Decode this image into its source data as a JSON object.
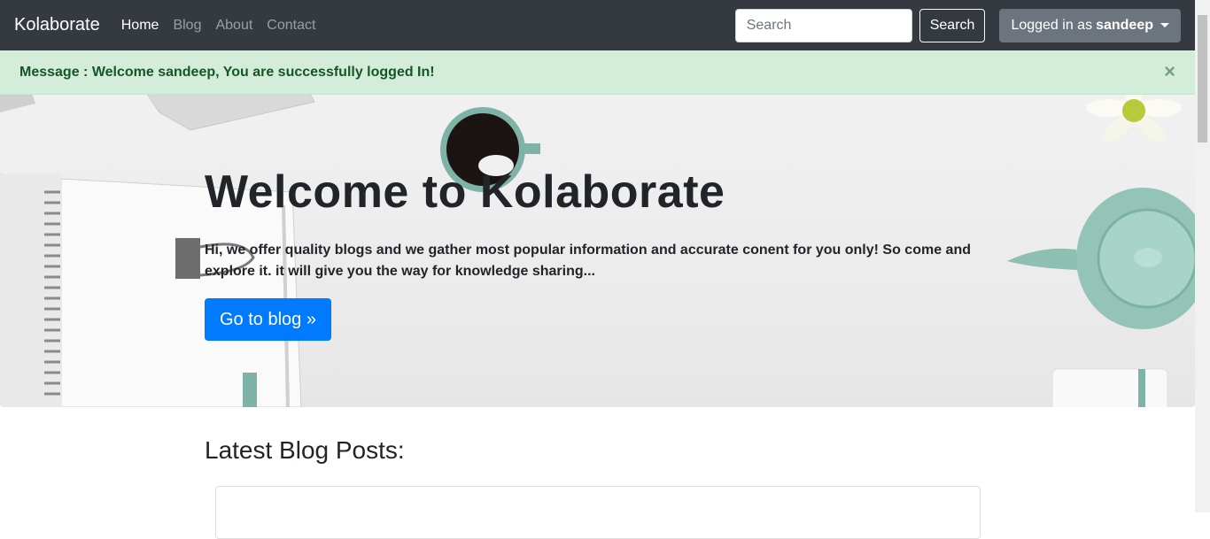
{
  "navbar": {
    "brand": "Kolaborate",
    "links": [
      "Home",
      "Blog",
      "About",
      "Contact"
    ],
    "search_placeholder": "Search",
    "search_button": "Search",
    "user_prefix": "Logged in as",
    "user_name": "sandeep"
  },
  "alert": {
    "message": "Message : Welcome sandeep, You are successfully logged In!",
    "close": "×"
  },
  "hero": {
    "title": "Welcome to Kolaborate",
    "text": "Hi, we offer quality blogs and we gather most popular information and accurate conent for you only! So come and explore it. it will give you the way for knowledge sharing...",
    "button": "Go to blog »"
  },
  "latest": {
    "title": "Latest Blog Posts:"
  },
  "colors": {
    "navbar": "#343a40",
    "primary": "#007bff",
    "alert_bg": "#d4edda",
    "alert_text": "#155724"
  }
}
